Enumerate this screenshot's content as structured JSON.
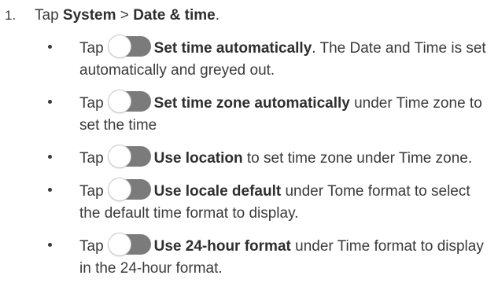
{
  "step": {
    "number": "1.",
    "prefix": "Tap ",
    "system": "System",
    "separator": " > ",
    "date_time": "Date & time",
    "suffix": "."
  },
  "toggle_icon": "toggle-switch-off-icon",
  "bullets": [
    {
      "tap": "Tap",
      "bold": "Set time automatically",
      "rest": ". The Date and Time is set automatically and greyed out."
    },
    {
      "tap": "Tap",
      "bold": "Set time zone automatically",
      "rest": " under Time zone to set the time"
    },
    {
      "tap": "Tap",
      "bold": "Use location",
      "rest": " to set time zone under Time zone."
    },
    {
      "tap": "Tap",
      "bold": "Use locale default",
      "rest": " under Tome format to select the default time format to display."
    },
    {
      "tap": "Tap",
      "bold": "Use 24-hour format",
      "rest": " under Time format to display in the 24-hour format."
    }
  ]
}
